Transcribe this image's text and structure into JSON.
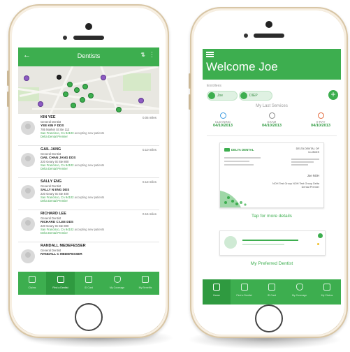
{
  "left_phone": {
    "appbar": {
      "title": "Dentists"
    },
    "dentists": [
      {
        "name": "KIN YEE",
        "specialty": "General Dentist",
        "practice": "YEE KIN F DDS",
        "address": "785 Market St Ste 112",
        "city": "San Francisco, CA 94103",
        "network": "Delta Dental Premier",
        "status": "accepting new patients",
        "distance": "0.05 miles"
      },
      {
        "name": "GAIL JANG",
        "specialty": "General Dentist",
        "practice": "GAIL CHAN JANG DDS",
        "address": "220 Geary St Ste 800",
        "city": "San Francisco, CA 94102",
        "network": "Delta Dental Premier",
        "status": "accepting new patients",
        "distance": "0.10 miles"
      },
      {
        "name": "SALLY ENG",
        "specialty": "General Dentist",
        "practice": "SALLY N ENG DDS",
        "address": "220 Geary St Ste 400",
        "city": "San Francisco, CA 94102",
        "network": "Delta Dental Premier",
        "status": "accepting new patients",
        "distance": "0.13 miles"
      },
      {
        "name": "RICHARD LEE",
        "specialty": "General Dentist",
        "practice": "RICHARD C LEE DDS",
        "address": "220 Geary St Ste 800",
        "city": "San Francisco, CA 94102",
        "network": "Delta Dental Premier",
        "status": "accepting new patients",
        "distance": "0.16 miles"
      },
      {
        "name": "RANDALL MEDEFESSER",
        "specialty": "General Dentist",
        "practice": "RANDALL C MEDEFESSER",
        "address": "",
        "city": "",
        "network": "",
        "status": "",
        "distance": ""
      }
    ],
    "tabs": [
      "Claims",
      "Find a Dentist",
      "ID Card",
      "My Coverage",
      "My Benefits"
    ]
  },
  "right_phone": {
    "welcome": "Welcome Joe",
    "enrollees_label": "Enrollees",
    "enrollees": [
      "Joe",
      "DIEP"
    ],
    "last_services_title": "My Last Services",
    "services": [
      {
        "name": "CLEANING",
        "date": "04/10/2013",
        "color": "#3c9be0"
      },
      {
        "name": "EXAM",
        "date": "04/10/2013",
        "color": "#8a8a8a"
      },
      {
        "name": "X-RAY",
        "date": "04/10/2013",
        "color": "#e3683a"
      }
    ],
    "id_card": {
      "brand": "DELTA DENTAL",
      "issuer": "DELTA DENTAL OF ILLINOIS",
      "member": "Joe NOH",
      "group": "NOH Test Group NOH Test Group Delta Dental Premier"
    },
    "tap_details": "Tap for more details",
    "preferred_title": "My Preferred Dentist",
    "tabs": [
      "Home",
      "Find a Dentist",
      "ID Card",
      "My Coverage",
      "My Claims"
    ]
  },
  "colors": {
    "brand_green": "#3dae4f",
    "gold_frame": "#e2d2b8"
  }
}
